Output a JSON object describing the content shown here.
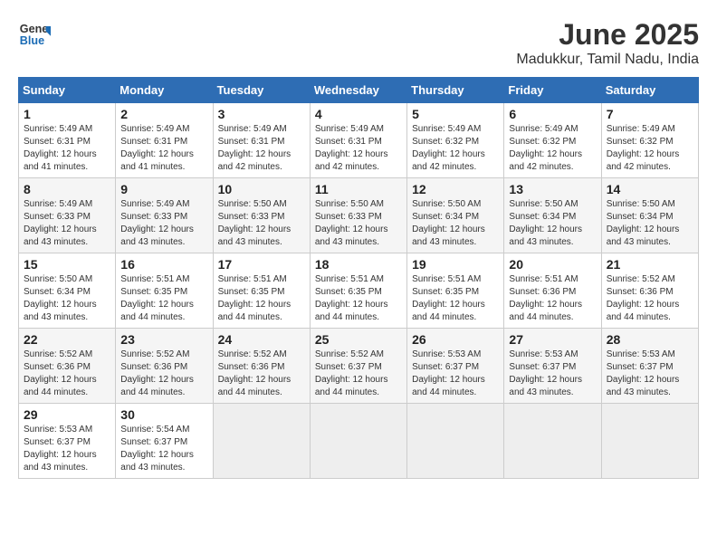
{
  "header": {
    "logo_general": "General",
    "logo_blue": "Blue",
    "month_title": "June 2025",
    "location": "Madukkur, Tamil Nadu, India"
  },
  "weekdays": [
    "Sunday",
    "Monday",
    "Tuesday",
    "Wednesday",
    "Thursday",
    "Friday",
    "Saturday"
  ],
  "weeks": [
    [
      {
        "day": "1",
        "sunrise": "Sunrise: 5:49 AM",
        "sunset": "Sunset: 6:31 PM",
        "daylight": "Daylight: 12 hours and 41 minutes."
      },
      {
        "day": "2",
        "sunrise": "Sunrise: 5:49 AM",
        "sunset": "Sunset: 6:31 PM",
        "daylight": "Daylight: 12 hours and 41 minutes."
      },
      {
        "day": "3",
        "sunrise": "Sunrise: 5:49 AM",
        "sunset": "Sunset: 6:31 PM",
        "daylight": "Daylight: 12 hours and 42 minutes."
      },
      {
        "day": "4",
        "sunrise": "Sunrise: 5:49 AM",
        "sunset": "Sunset: 6:31 PM",
        "daylight": "Daylight: 12 hours and 42 minutes."
      },
      {
        "day": "5",
        "sunrise": "Sunrise: 5:49 AM",
        "sunset": "Sunset: 6:32 PM",
        "daylight": "Daylight: 12 hours and 42 minutes."
      },
      {
        "day": "6",
        "sunrise": "Sunrise: 5:49 AM",
        "sunset": "Sunset: 6:32 PM",
        "daylight": "Daylight: 12 hours and 42 minutes."
      },
      {
        "day": "7",
        "sunrise": "Sunrise: 5:49 AM",
        "sunset": "Sunset: 6:32 PM",
        "daylight": "Daylight: 12 hours and 42 minutes."
      }
    ],
    [
      {
        "day": "8",
        "sunrise": "Sunrise: 5:49 AM",
        "sunset": "Sunset: 6:33 PM",
        "daylight": "Daylight: 12 hours and 43 minutes."
      },
      {
        "day": "9",
        "sunrise": "Sunrise: 5:49 AM",
        "sunset": "Sunset: 6:33 PM",
        "daylight": "Daylight: 12 hours and 43 minutes."
      },
      {
        "day": "10",
        "sunrise": "Sunrise: 5:50 AM",
        "sunset": "Sunset: 6:33 PM",
        "daylight": "Daylight: 12 hours and 43 minutes."
      },
      {
        "day": "11",
        "sunrise": "Sunrise: 5:50 AM",
        "sunset": "Sunset: 6:33 PM",
        "daylight": "Daylight: 12 hours and 43 minutes."
      },
      {
        "day": "12",
        "sunrise": "Sunrise: 5:50 AM",
        "sunset": "Sunset: 6:34 PM",
        "daylight": "Daylight: 12 hours and 43 minutes."
      },
      {
        "day": "13",
        "sunrise": "Sunrise: 5:50 AM",
        "sunset": "Sunset: 6:34 PM",
        "daylight": "Daylight: 12 hours and 43 minutes."
      },
      {
        "day": "14",
        "sunrise": "Sunrise: 5:50 AM",
        "sunset": "Sunset: 6:34 PM",
        "daylight": "Daylight: 12 hours and 43 minutes."
      }
    ],
    [
      {
        "day": "15",
        "sunrise": "Sunrise: 5:50 AM",
        "sunset": "Sunset: 6:34 PM",
        "daylight": "Daylight: 12 hours and 43 minutes."
      },
      {
        "day": "16",
        "sunrise": "Sunrise: 5:51 AM",
        "sunset": "Sunset: 6:35 PM",
        "daylight": "Daylight: 12 hours and 44 minutes."
      },
      {
        "day": "17",
        "sunrise": "Sunrise: 5:51 AM",
        "sunset": "Sunset: 6:35 PM",
        "daylight": "Daylight: 12 hours and 44 minutes."
      },
      {
        "day": "18",
        "sunrise": "Sunrise: 5:51 AM",
        "sunset": "Sunset: 6:35 PM",
        "daylight": "Daylight: 12 hours and 44 minutes."
      },
      {
        "day": "19",
        "sunrise": "Sunrise: 5:51 AM",
        "sunset": "Sunset: 6:35 PM",
        "daylight": "Daylight: 12 hours and 44 minutes."
      },
      {
        "day": "20",
        "sunrise": "Sunrise: 5:51 AM",
        "sunset": "Sunset: 6:36 PM",
        "daylight": "Daylight: 12 hours and 44 minutes."
      },
      {
        "day": "21",
        "sunrise": "Sunrise: 5:52 AM",
        "sunset": "Sunset: 6:36 PM",
        "daylight": "Daylight: 12 hours and 44 minutes."
      }
    ],
    [
      {
        "day": "22",
        "sunrise": "Sunrise: 5:52 AM",
        "sunset": "Sunset: 6:36 PM",
        "daylight": "Daylight: 12 hours and 44 minutes."
      },
      {
        "day": "23",
        "sunrise": "Sunrise: 5:52 AM",
        "sunset": "Sunset: 6:36 PM",
        "daylight": "Daylight: 12 hours and 44 minutes."
      },
      {
        "day": "24",
        "sunrise": "Sunrise: 5:52 AM",
        "sunset": "Sunset: 6:36 PM",
        "daylight": "Daylight: 12 hours and 44 minutes."
      },
      {
        "day": "25",
        "sunrise": "Sunrise: 5:52 AM",
        "sunset": "Sunset: 6:37 PM",
        "daylight": "Daylight: 12 hours and 44 minutes."
      },
      {
        "day": "26",
        "sunrise": "Sunrise: 5:53 AM",
        "sunset": "Sunset: 6:37 PM",
        "daylight": "Daylight: 12 hours and 44 minutes."
      },
      {
        "day": "27",
        "sunrise": "Sunrise: 5:53 AM",
        "sunset": "Sunset: 6:37 PM",
        "daylight": "Daylight: 12 hours and 43 minutes."
      },
      {
        "day": "28",
        "sunrise": "Sunrise: 5:53 AM",
        "sunset": "Sunset: 6:37 PM",
        "daylight": "Daylight: 12 hours and 43 minutes."
      }
    ],
    [
      {
        "day": "29",
        "sunrise": "Sunrise: 5:53 AM",
        "sunset": "Sunset: 6:37 PM",
        "daylight": "Daylight: 12 hours and 43 minutes."
      },
      {
        "day": "30",
        "sunrise": "Sunrise: 5:54 AM",
        "sunset": "Sunset: 6:37 PM",
        "daylight": "Daylight: 12 hours and 43 minutes."
      },
      null,
      null,
      null,
      null,
      null
    ]
  ]
}
